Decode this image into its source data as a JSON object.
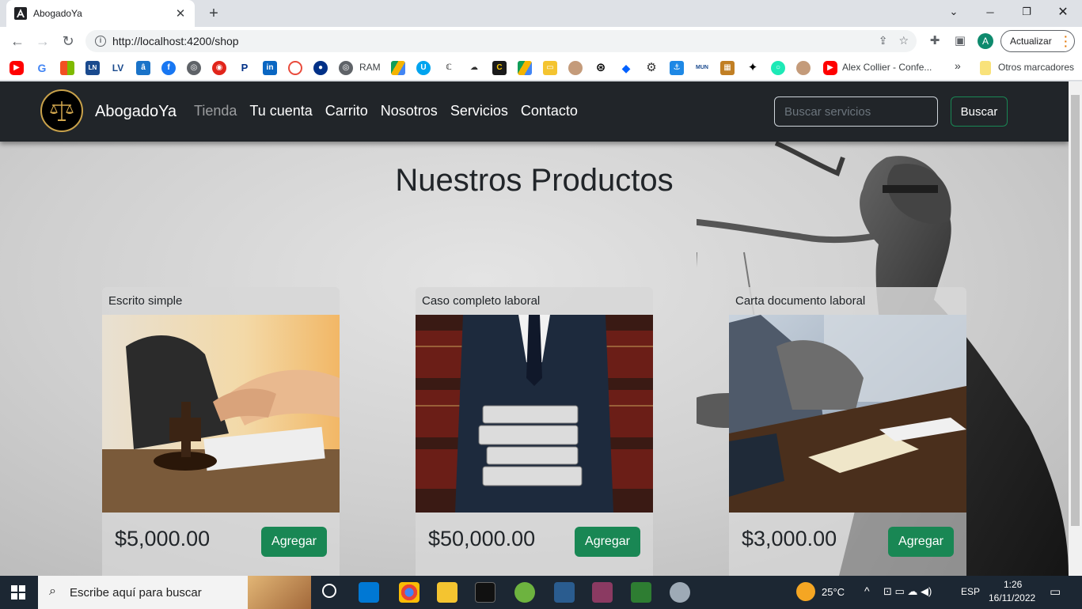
{
  "browser": {
    "tab_title": "AbogadoYa",
    "url": "http://localhost:4200/shop",
    "update_label": "Actualizar",
    "profile_initial": "A"
  },
  "bookmarks": {
    "ram_label": "RAM",
    "ln_label": "LN",
    "lv_label": "LV",
    "alex_label": "Alex Collier - Confe...",
    "more_label": "»",
    "other_label": "Otros marcadores"
  },
  "navbar": {
    "brand": "AbogadoYa",
    "links": [
      "Tienda",
      "Tu cuenta",
      "Carrito",
      "Nosotros",
      "Servicios",
      "Contacto"
    ],
    "search_placeholder": "Buscar servicios",
    "search_button": "Buscar"
  },
  "main": {
    "heading": "Nuestros Productos",
    "products": [
      {
        "title": "Escrito simple",
        "price": "$5,000.00",
        "button": "Agregar"
      },
      {
        "title": "Caso completo laboral",
        "price": "$50,000.00",
        "button": "Agregar"
      },
      {
        "title": "Carta documento laboral",
        "price": "$3,000.00",
        "button": "Agregar"
      }
    ]
  },
  "taskbar": {
    "search_placeholder": "Escribe aquí para buscar",
    "temperature": "25°C",
    "language": "ESP",
    "time": "1:26",
    "date": "16/11/2022"
  },
  "colors": {
    "navbar_bg": "#212529",
    "accent_green": "#198754"
  }
}
